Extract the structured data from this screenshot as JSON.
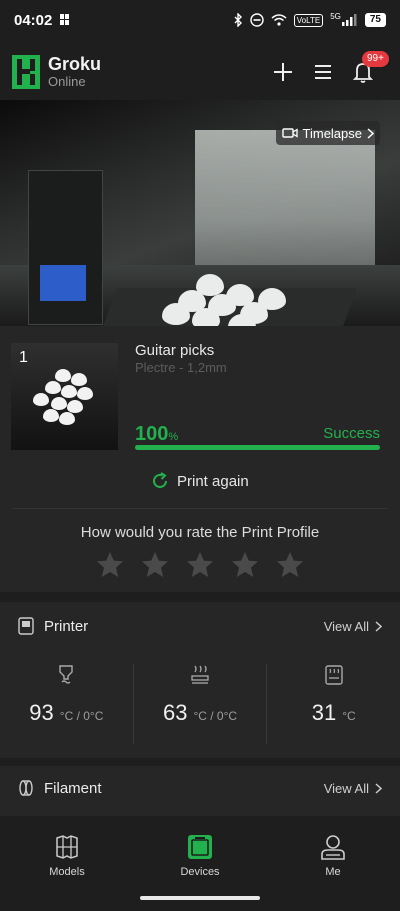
{
  "status_bar": {
    "time": "04:02",
    "network": "5G",
    "volte": "VoLTE",
    "battery": "75"
  },
  "header": {
    "title": "Groku",
    "subtitle": "Online",
    "notification_badge": "99+"
  },
  "camera": {
    "timelapse_label": "Timelapse"
  },
  "print_job": {
    "plate_number": "1",
    "name": "Guitar picks",
    "profile": "Plectre - 1,2mm",
    "progress_value": "100",
    "progress_unit": "%",
    "progress_fraction": 1.0,
    "status": "Success",
    "print_again_label": "Print again",
    "rating_question": "How would you rate the Print Profile",
    "rating_stars_total": 5,
    "rating_value": 0
  },
  "printer_section": {
    "title": "Printer",
    "view_all": "View All",
    "temps": [
      {
        "icon": "nozzle-temp-icon",
        "value": "93",
        "unit": "°C / 0°C"
      },
      {
        "icon": "bed-temp-icon",
        "value": "63",
        "unit": "°C / 0°C"
      },
      {
        "icon": "chamber-temp-icon",
        "value": "31",
        "unit": "°C"
      }
    ]
  },
  "filament_section": {
    "title": "Filament",
    "view_all": "View All"
  },
  "bottom_nav": {
    "items": [
      {
        "label": "Models",
        "active": false
      },
      {
        "label": "Devices",
        "active": true
      },
      {
        "label": "Me",
        "active": false
      }
    ]
  },
  "colors": {
    "accent": "#22b14c",
    "background": "#1e1e1e",
    "card": "#262626",
    "badge": "#e5393f"
  }
}
